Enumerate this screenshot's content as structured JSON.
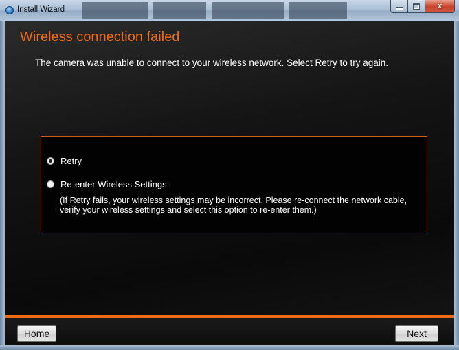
{
  "window": {
    "title": "Install Wizard"
  },
  "header": {
    "heading": "Wireless connection failed",
    "message": "The camera was unable to connect to your wireless network. Select Retry to try again."
  },
  "options": [
    {
      "label": "Retry",
      "selected": true
    },
    {
      "label": "Re-enter Wireless Settings",
      "selected": false,
      "description": "(If Retry fails, your wireless settings may be incorrect. Please re-connect the network cable, verify your wireless settings and select this option to re-enter them.)"
    }
  ],
  "footer": {
    "home_label": "Home",
    "next_label": "Next"
  },
  "colors": {
    "accent": "#ef6a12",
    "heading": "#f06a15",
    "background": "#0b0b0b"
  },
  "icons": {
    "app": "globe-icon",
    "minimize": "minimize-icon",
    "maximize": "maximize-icon",
    "close": "close-icon",
    "radio": "radio-button-icon"
  }
}
